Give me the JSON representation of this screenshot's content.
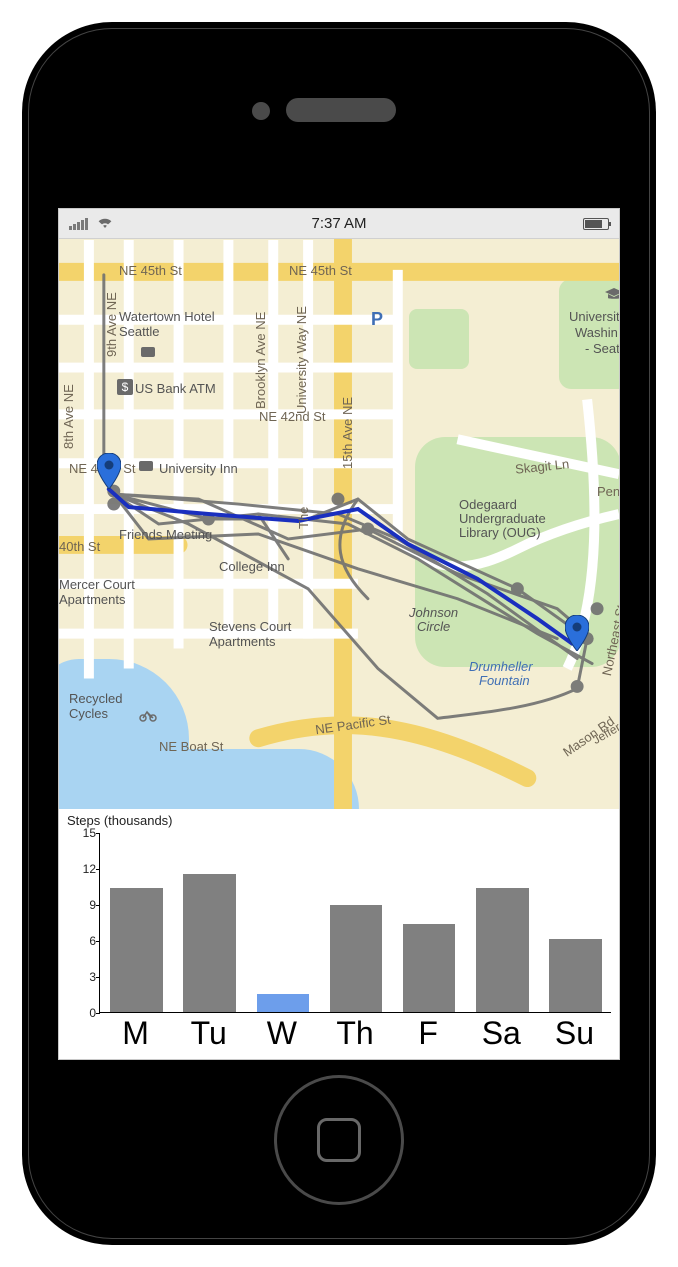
{
  "status_bar": {
    "time": "7:37 AM"
  },
  "map": {
    "places": {
      "watertown": "Watertown Hotel Seattle",
      "usbank": "US Bank ATM",
      "univinn": "University Inn",
      "mercer": "Mercer Court Apartments",
      "stevens": "Stevens Court Apartments",
      "recycled": "Recycled Cycles",
      "collegeinn": "College Inn",
      "meeting": "Friends Meeting",
      "odegaard1": "Odegaard",
      "odegaard2": "Undergraduate",
      "odegaard3": "Library (OUG)",
      "johnson1": "Johnson",
      "johnson2": "Circle",
      "drumheller1": "Drumheller",
      "drumheller2": "Fountain",
      "uw1": "Universit",
      "uw2": "Washin",
      "uw3": "- Seat"
    },
    "roads": {
      "ne45a": "NE 45th St",
      "ne45b": "NE 45th St",
      "ne42nd": "NE 42nd St",
      "ne42nd_b": "NE 42nd St",
      "ne40": "40th St",
      "npacific": "NE Pacific St",
      "neboat": "NE Boat St",
      "ave8": "8th Ave NE",
      "ave9": "9th Ave NE",
      "ave15": "15th Ave NE",
      "brooklyn": "Brooklyn Ave NE",
      "univway": "University Way NE",
      "skagit": "Skagit Ln",
      "stevensway": "Northeast Stevens Way",
      "mason": "Mason Rd",
      "jefferson": "Jefferson Rd",
      "pend": "Pend",
      "parking": "P",
      "the": "The"
    }
  },
  "chart_data": {
    "type": "bar",
    "title": "Steps (thousands)",
    "categories": [
      "M",
      "Tu",
      "W",
      "Th",
      "F",
      "Sa",
      "Su"
    ],
    "values": [
      10.3,
      11.5,
      1.5,
      8.9,
      7.3,
      10.3,
      6.1
    ],
    "ylim": [
      0,
      15
    ],
    "yticks": [
      0,
      3,
      6,
      9,
      12,
      15
    ],
    "highlight_index": 2,
    "xlabel": "",
    "ylabel": ""
  },
  "colors": {
    "bar_default": "#808080",
    "bar_highlight": "#6d9eeb",
    "map_marker": "#2a6fdb",
    "map_road_major": "#f4d35e",
    "map_road_minor": "#ffffff",
    "map_bg": "#f4eed3",
    "map_park": "#cce5b4",
    "map_water": "#a9d4f2",
    "path_gray": "#707070",
    "path_blue": "#1a2fbf"
  }
}
